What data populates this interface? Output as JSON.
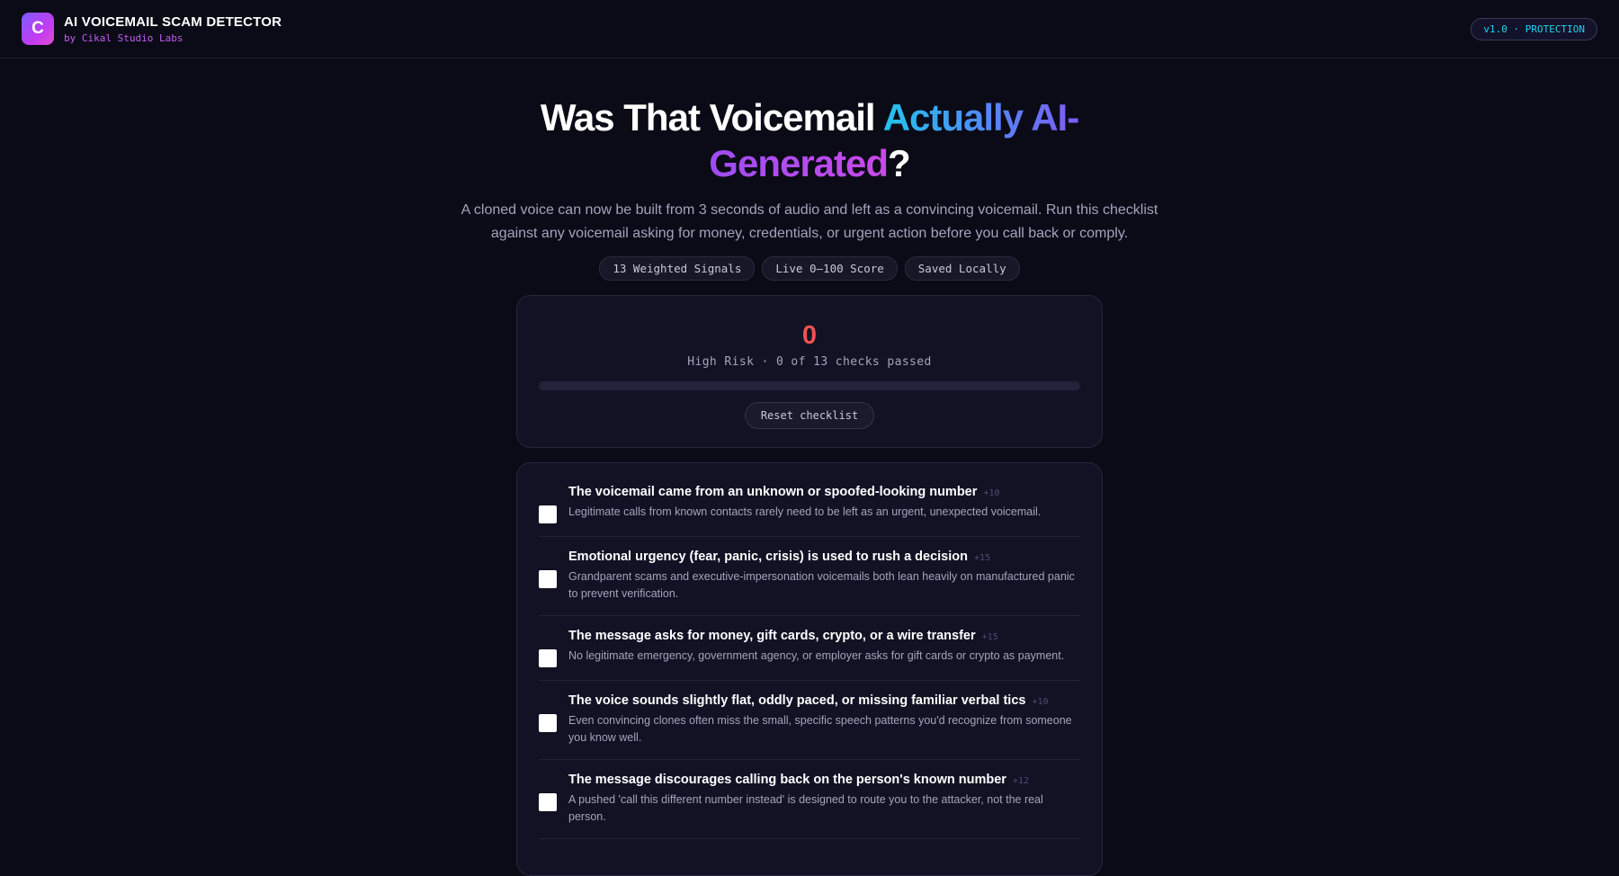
{
  "header": {
    "logo_letter": "C",
    "title": "AI VOICEMAIL SCAM DETECTOR",
    "subtitle": "by Cikal Studio Labs",
    "version_badge": "v1.0 · PROTECTION"
  },
  "hero": {
    "title_part1": "Was That Voicemail ",
    "title_part2": "Actually AI-",
    "title_part3": "Generated",
    "title_part4": "?",
    "description": "A cloned voice can now be built from 3 seconds of audio and left as a convincing voicemail. Run this checklist against any voicemail asking for money, credentials, or urgent action before you call back or comply.",
    "pills": [
      "13 Weighted Signals",
      "Live 0–100 Score",
      "Saved Locally"
    ]
  },
  "score": {
    "value": "0",
    "status": "High Risk · 0 of 13 checks passed",
    "progress_fraction": 0,
    "reset_label": "Reset checklist"
  },
  "checklist": [
    {
      "title": "The voicemail came from an unknown or spoofed-looking number",
      "weight": "+10",
      "description": "Legitimate calls from known contacts rarely need to be left as an urgent, unexpected voicemail.",
      "checked": false
    },
    {
      "title": "Emotional urgency (fear, panic, crisis) is used to rush a decision",
      "weight": "+15",
      "description": "Grandparent scams and executive-impersonation voicemails both lean heavily on manufactured panic to prevent verification.",
      "checked": false
    },
    {
      "title": "The message asks for money, gift cards, crypto, or a wire transfer",
      "weight": "+15",
      "description": "No legitimate emergency, government agency, or employer asks for gift cards or crypto as payment.",
      "checked": false
    },
    {
      "title": "The voice sounds slightly flat, oddly paced, or missing familiar verbal tics",
      "weight": "+10",
      "description": "Even convincing clones often miss the small, specific speech patterns you'd recognize from someone you know well.",
      "checked": false
    },
    {
      "title": "The message discourages calling back on the person's known number",
      "weight": "+12",
      "description": "A pushed 'call this different number instead' is designed to route you to the attacker, not the real person.",
      "checked": false
    }
  ],
  "colors": {
    "background": "#0b0b17",
    "card": "#121224",
    "risk_red": "#f05252",
    "accent_cyan": "#22d3ee",
    "accent_purple": "#c35cf2"
  }
}
